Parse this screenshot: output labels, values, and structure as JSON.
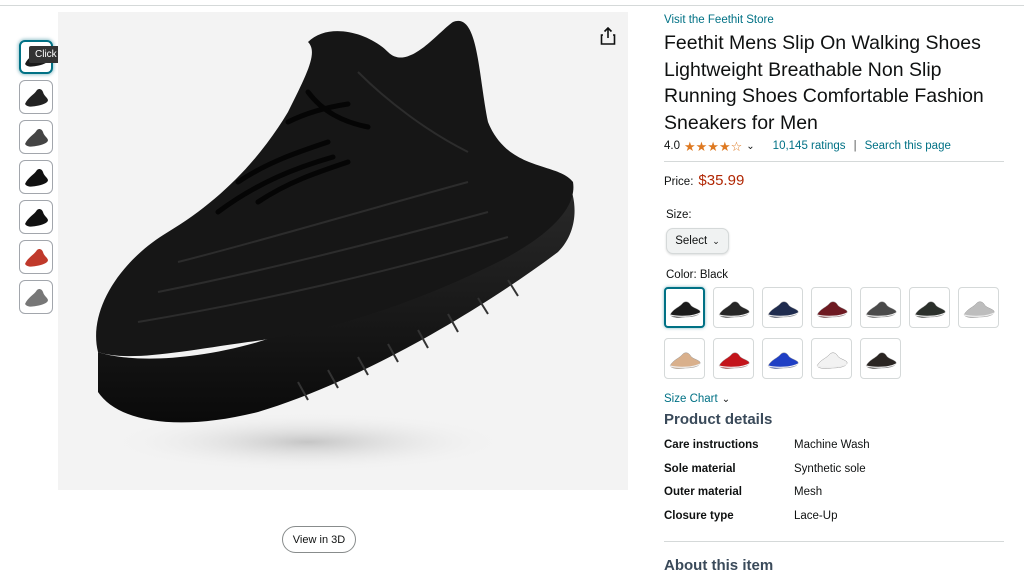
{
  "thumbnails": {
    "tooltip": "Click to select Black",
    "items": [
      {
        "icon": "shoe-black-side-icon",
        "tone": "#1a1a1a"
      },
      {
        "icon": "shoe-sole-detail-icon",
        "tone": "#222"
      },
      {
        "icon": "shoe-comfort-detail-icon",
        "tone": "#444"
      },
      {
        "icon": "shoe-pair-icon",
        "tone": "#111"
      },
      {
        "icon": "shoe-pair-top-icon",
        "tone": "#111"
      },
      {
        "icon": "shoe-lifestyle-icon",
        "tone": "#c0392b"
      },
      {
        "icon": "shoe-box-icon",
        "tone": "#777"
      }
    ]
  },
  "main_image": {
    "view3d_label": "View in 3D",
    "share_icon": "share-icon"
  },
  "product": {
    "store_link": "Visit the Feethit Store",
    "title": "Feethit Mens Slip On Walking Shoes Lightweight Breathable Non Slip Running Shoes Comfortable Fashion Sneakers for Men",
    "rating": "4.0",
    "stars": "★★★★☆",
    "ratings_count": "10,145 ratings",
    "separator": "|",
    "search_link": "Search this page",
    "price_label": "Price:",
    "price": "$35.99",
    "size_label": "Size:",
    "size_select": "Select",
    "color_label": "Color:",
    "color_value": "Black",
    "colors": [
      {
        "name": "Black",
        "hex": "#1b1b1b",
        "selected": true
      },
      {
        "name": "Black/White",
        "hex": "#262626"
      },
      {
        "name": "Navy",
        "hex": "#1f2c4f"
      },
      {
        "name": "Burgundy",
        "hex": "#6e1a22"
      },
      {
        "name": "Grey",
        "hex": "#4a4a4a"
      },
      {
        "name": "Dark Green",
        "hex": "#2b302b"
      },
      {
        "name": "Light Grey",
        "hex": "#bdbdbd"
      },
      {
        "name": "Khaki",
        "hex": "#d9b08c"
      },
      {
        "name": "Red",
        "hex": "#c3141b"
      },
      {
        "name": "Blue",
        "hex": "#1f3fc4"
      },
      {
        "name": "White",
        "hex": "#f2f2f2"
      },
      {
        "name": "Black/Brown",
        "hex": "#2a2522"
      }
    ],
    "size_chart": "Size Chart",
    "details_title": "Product details",
    "details": [
      {
        "key": "Care instructions",
        "value": "Machine Wash"
      },
      {
        "key": "Sole material",
        "value": "Synthetic sole"
      },
      {
        "key": "Outer material",
        "value": "Mesh"
      },
      {
        "key": "Closure type",
        "value": "Lace-Up"
      }
    ],
    "about_title": "About this item"
  }
}
